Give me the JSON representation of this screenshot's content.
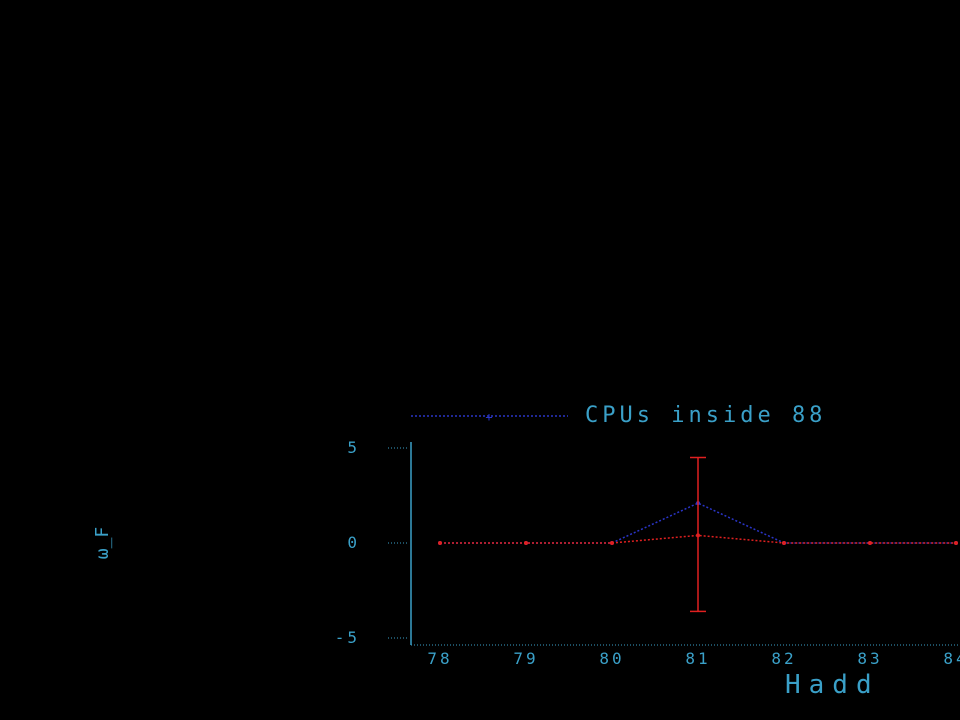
{
  "chart_data": {
    "type": "line",
    "title": "",
    "xlabel": "Hadd",
    "ylabel": "ω_F",
    "x": [
      78,
      79,
      80,
      81,
      82,
      83,
      84
    ],
    "x_tick_labels": [
      "78",
      "79",
      "80",
      "81",
      "82",
      "83",
      "84"
    ],
    "xlim": [
      77.8,
      84.2
    ],
    "y_ticks": [
      -5,
      0,
      5
    ],
    "y_tick_labels": [
      "-5",
      "0",
      "5"
    ],
    "ylim": [
      -5.3,
      5.3
    ],
    "legend": {
      "placement": "top",
      "entries": [
        "CPUs inside 88"
      ]
    },
    "series": [
      {
        "name": "CPUs inside 88",
        "color": "#2a35c8",
        "values": [
          0,
          0,
          0,
          2.1,
          0,
          0,
          0
        ]
      },
      {
        "name": "",
        "color": "#e02020",
        "values": [
          0,
          0,
          0,
          0.4,
          0,
          0,
          0
        ],
        "error_bars": [
          {
            "x": 81,
            "low": -3.6,
            "high": 4.5
          }
        ]
      }
    ],
    "grid": false
  }
}
